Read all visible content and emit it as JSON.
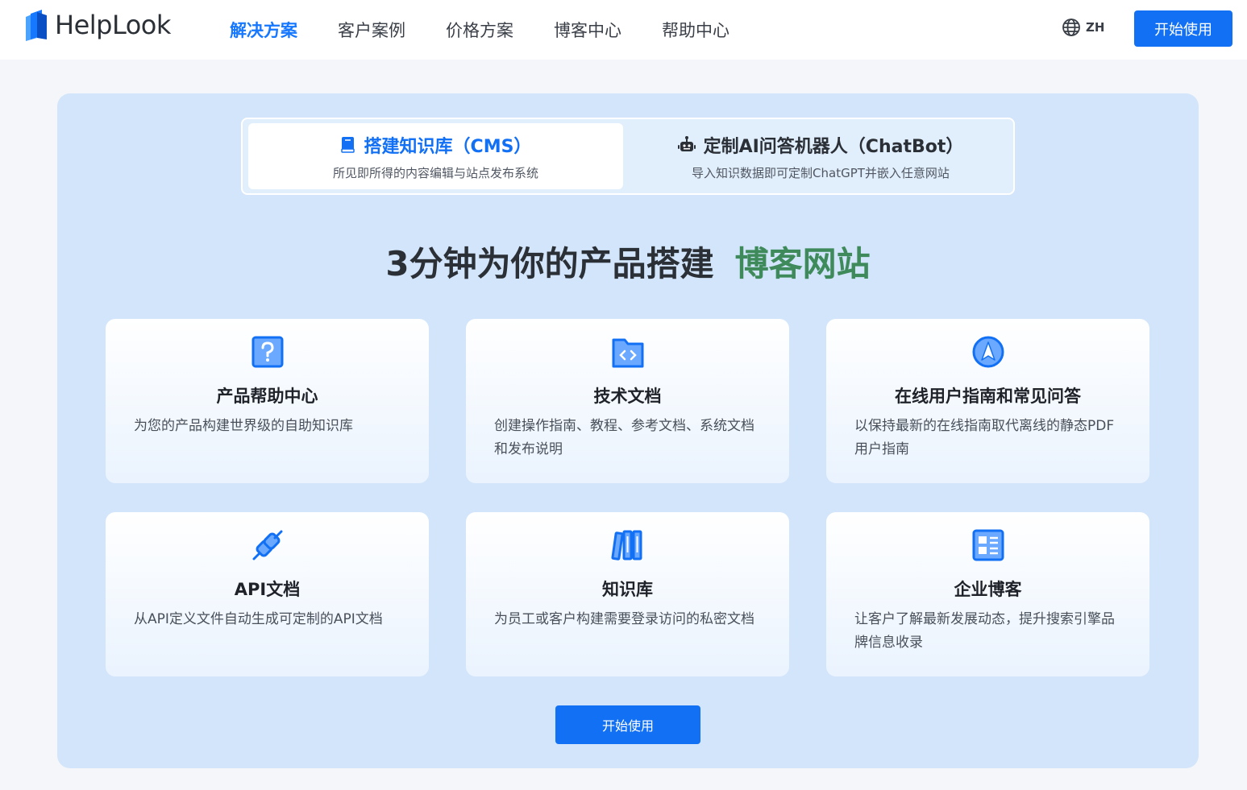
{
  "brand": {
    "name": "HelpLook"
  },
  "nav": {
    "items": [
      {
        "label": "解决方案",
        "active": true
      },
      {
        "label": "客户案例",
        "active": false
      },
      {
        "label": "价格方案",
        "active": false
      },
      {
        "label": "博客中心",
        "active": false
      },
      {
        "label": "帮助中心",
        "active": false
      }
    ]
  },
  "header": {
    "lang": "ZH",
    "start_label": "开始使用"
  },
  "tabs": [
    {
      "title": "搭建知识库（CMS）",
      "subtitle": "所见即所得的内容编辑与站点发布系统",
      "icon": "book-icon",
      "selected": true
    },
    {
      "title": "定制AI问答机器人（ChatBot）",
      "subtitle": "导入知识数据即可定制ChatGPT并嵌入任意网站",
      "icon": "robot-icon",
      "selected": false
    }
  ],
  "headline": {
    "main": "3分钟为你的产品搭建",
    "highlight": "博客网站"
  },
  "cards": [
    {
      "title": "产品帮助中心",
      "desc": "为您的产品构建世界级的自助知识库",
      "icon": "question-icon"
    },
    {
      "title": "技术文档",
      "desc": "创建操作指南、教程、参考文档、系统文档和发布说明",
      "icon": "code-folder-icon"
    },
    {
      "title": "在线用户指南和常见问答",
      "desc": "以保持最新的在线指南取代离线的静态PDF用户指南",
      "icon": "navigation-icon"
    },
    {
      "title": "API文档",
      "desc": "从API定义文件自动生成可定制的API文档",
      "icon": "plug-icon"
    },
    {
      "title": "知识库",
      "desc": "为员工或客户构建需要登录访问的私密文档",
      "icon": "books-icon"
    },
    {
      "title": "企业博客",
      "desc": "让客户了解最新发展动态，提升搜索引擎品牌信息收录",
      "icon": "article-icon"
    }
  ],
  "cta": {
    "label": "开始使用"
  },
  "colors": {
    "accent": "#1270f5",
    "highlight": "#3e8a5a",
    "panel": "#d2e5fb"
  }
}
